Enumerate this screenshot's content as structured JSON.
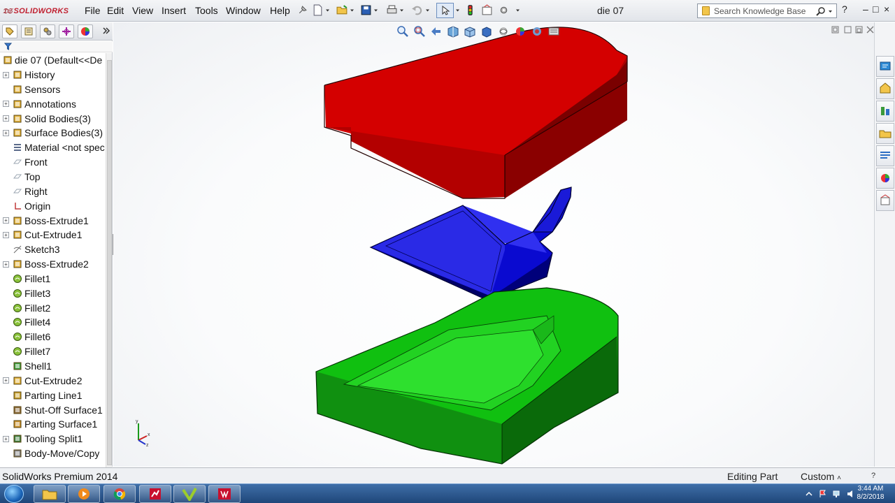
{
  "app": {
    "brand": "SOLIDWORKS",
    "document_title": "die 07"
  },
  "menu": [
    "File",
    "Edit",
    "View",
    "Insert",
    "Tools",
    "Window",
    "Help"
  ],
  "search": {
    "placeholder": "Search Knowledge Base"
  },
  "window_controls": [
    "?",
    "–",
    "□",
    "×"
  ],
  "feature_tree": {
    "root": "die 07  (Default<<De",
    "items": [
      {
        "label": "History",
        "icon": "history-icon",
        "expandable": true
      },
      {
        "label": "Sensors",
        "icon": "sensors-icon",
        "expandable": false
      },
      {
        "label": "Annotations",
        "icon": "annotations-icon",
        "expandable": true
      },
      {
        "label": "Solid Bodies(3)",
        "icon": "solid-bodies-icon",
        "expandable": true
      },
      {
        "label": "Surface Bodies(3)",
        "icon": "surface-bodies-icon",
        "expandable": true
      },
      {
        "label": "Material <not spec",
        "icon": "material-icon",
        "expandable": false
      },
      {
        "label": "Front",
        "icon": "plane-icon",
        "expandable": false
      },
      {
        "label": "Top",
        "icon": "plane-icon",
        "expandable": false
      },
      {
        "label": "Right",
        "icon": "plane-icon",
        "expandable": false
      },
      {
        "label": "Origin",
        "icon": "origin-icon",
        "expandable": false
      },
      {
        "label": "Boss-Extrude1",
        "icon": "extrude-icon",
        "expandable": true
      },
      {
        "label": "Cut-Extrude1",
        "icon": "cut-extrude-icon",
        "expandable": true
      },
      {
        "label": "Sketch3",
        "icon": "sketch-icon",
        "expandable": false
      },
      {
        "label": "Boss-Extrude2",
        "icon": "extrude-icon",
        "expandable": true
      },
      {
        "label": "Fillet1",
        "icon": "fillet-icon",
        "expandable": false
      },
      {
        "label": "Fillet3",
        "icon": "fillet-icon",
        "expandable": false
      },
      {
        "label": "Fillet2",
        "icon": "fillet-icon",
        "expandable": false
      },
      {
        "label": "Fillet4",
        "icon": "fillet-icon",
        "expandable": false
      },
      {
        "label": "Fillet6",
        "icon": "fillet-icon",
        "expandable": false
      },
      {
        "label": "Fillet7",
        "icon": "fillet-icon",
        "expandable": false
      },
      {
        "label": "Shell1",
        "icon": "shell-icon",
        "expandable": false
      },
      {
        "label": "Cut-Extrude2",
        "icon": "cut-extrude-icon",
        "expandable": true
      },
      {
        "label": "Parting Line1",
        "icon": "parting-line-icon",
        "expandable": false
      },
      {
        "label": "Shut-Off Surface1",
        "icon": "shutoff-surface-icon",
        "expandable": false
      },
      {
        "label": "Parting Surface1",
        "icon": "parting-surface-icon",
        "expandable": false
      },
      {
        "label": "Tooling Split1",
        "icon": "tooling-split-icon",
        "expandable": true
      },
      {
        "label": "Body-Move/Copy",
        "icon": "move-body-icon",
        "expandable": false
      }
    ]
  },
  "model_colors": {
    "top_core": "#d40000",
    "part": "#0a0ad0",
    "bottom_cavity": "#10c010"
  },
  "triad_labels": {
    "x": "x",
    "y": "y",
    "z": "z"
  },
  "status": {
    "product": "SolidWorks Premium 2014",
    "mode": "Editing Part",
    "units": "Custom",
    "units_arrow": "˄",
    "help": "?"
  },
  "taskbar": {
    "clock_time": "3:44 AM",
    "clock_date": "8/2/2018"
  }
}
